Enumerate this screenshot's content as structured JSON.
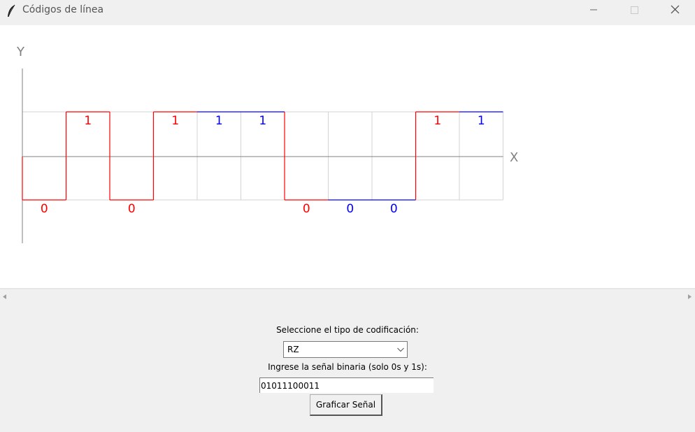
{
  "window": {
    "title": "Códigos de línea",
    "icon": "feather-icon",
    "controls": [
      "minimize-icon",
      "maximize-icon",
      "close-icon"
    ]
  },
  "plot": {
    "y_axis_label": "Y",
    "x_axis_label": "X",
    "bits": [
      "0",
      "1",
      "0",
      "1",
      "1",
      "1",
      "0",
      "0",
      "0",
      "1",
      "1"
    ],
    "colors": {
      "blue": "#0000ff",
      "red": "#ff0000",
      "grid": "#d3d3d3",
      "axis": "#808080"
    }
  },
  "controls": {
    "coding_label": "Seleccione el tipo de codificación:",
    "coding_selected": "RZ",
    "signal_label": "Ingrese la señal binaria (solo 0s y 1s):",
    "signal_value": "01011100011",
    "submit_label": "Graficar Señal"
  }
}
